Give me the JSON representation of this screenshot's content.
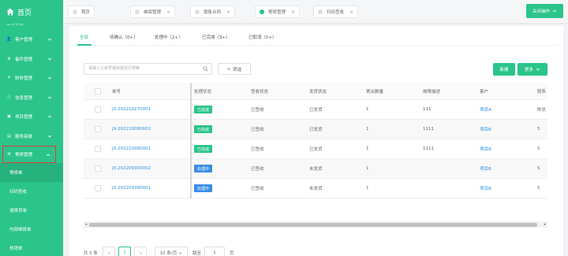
{
  "colors": {
    "brand": "#2bc48a",
    "link": "#2f8fd8",
    "done": "#2bc48a",
    "processing": "#3a8ee6",
    "highlight_border": "#e4393c"
  },
  "sidebar": {
    "home_label": "首页",
    "cut_label": "工作中心",
    "menu": [
      {
        "label": "客户管理",
        "icon": "user-icon"
      },
      {
        "label": "备件管理",
        "icon": "gear-icon"
      },
      {
        "label": "财务管理",
        "icon": "yen-icon"
      },
      {
        "label": "信息管理",
        "icon": "info-icon"
      },
      {
        "label": "项目管理",
        "icon": "folder-icon"
      },
      {
        "label": "服务商城",
        "icon": "shop-icon"
      },
      {
        "label": "寄修管理",
        "icon": "repair-icon"
      }
    ],
    "submenu": [
      "寄修单",
      "扫码签收",
      "退换货单",
      "内部维修单",
      "核销单"
    ]
  },
  "tabs": [
    {
      "label": "首页",
      "closable": false
    },
    {
      "label": "维保管理",
      "closable": true
    },
    {
      "label": "销售合同",
      "closable": true
    },
    {
      "label": "寄修管理",
      "closable": true,
      "active": true
    },
    {
      "label": "扫码签收",
      "closable": true
    }
  ],
  "close_ops_label": "关闭操作",
  "status_tabs": [
    "全部",
    "待确认（0+）",
    "处理中（2+）",
    "已完成（3+）",
    "已取消（0+）"
  ],
  "search": {
    "placeholder": "请输入工单号或标题进行搜索"
  },
  "filter_label": "筛选",
  "new_label": "新建",
  "more_label": "更多",
  "table": {
    "headers": [
      "单号",
      "处理状态",
      "签收状态",
      "发货状态",
      "寄出数量",
      "故障描述",
      "客户",
      "联系"
    ],
    "rows": [
      {
        "no": "JX-202210270001",
        "status": "已完成",
        "status_type": "done",
        "sign": "已签收",
        "ship": "已发货",
        "qty": "1",
        "fault": "111",
        "customer": "项目A",
        "contact": "陈总"
      },
      {
        "no": "JX-202210080002",
        "status": "已完成",
        "status_type": "done",
        "sign": "已签收",
        "ship": "已发货",
        "qty": "1",
        "fault": "1111",
        "customer": "项目B",
        "contact": "5"
      },
      {
        "no": "JX-202210080001",
        "status": "已完成",
        "status_type": "done",
        "sign": "已签收",
        "ship": "已发货",
        "qty": "1",
        "fault": "1111",
        "customer": "项目B",
        "contact": "5"
      },
      {
        "no": "JX-202209300002",
        "status": "处理中",
        "status_type": "processing",
        "sign": "已签收",
        "ship": "未发货",
        "qty": "1",
        "fault": "",
        "customer": "项目B",
        "contact": "5"
      },
      {
        "no": "JX-202209300001",
        "status": "处理中",
        "status_type": "processing",
        "sign": "已签收",
        "ship": "未发货",
        "qty": "1",
        "fault": "",
        "customer": "项目B",
        "contact": "5"
      }
    ]
  },
  "pagination": {
    "total": "共 5 条",
    "current": "1",
    "page_size": "10 条/页",
    "goto": "跳至",
    "goto_value": "1",
    "page_unit": "页"
  }
}
